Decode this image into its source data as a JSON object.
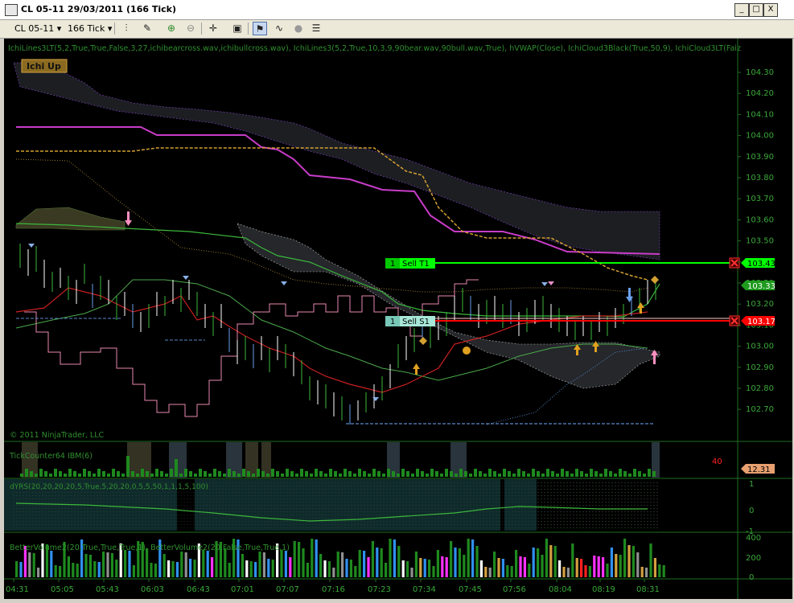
{
  "window": {
    "title": "CL 05-11  29/03/2011 (166 Tick)",
    "buttons": [
      "_",
      "□",
      "X"
    ]
  },
  "toolbar": {
    "instrument": "CL 05-11",
    "interval": "166 Tick"
  },
  "panel_main": {
    "indicator_line": "IchiLines3LT(5,2,True,True,False,3,27,ichibearcross.wav,ichibullcross.wav), IchiLines3(5,2,True,10,3,9,90bear.wav,90bull.wav,True), hVWAP(Close), IchiCloud3Black(True,50,9), IchiCloud3LT(Faiz",
    "badge": "Ichi Up",
    "copyright": "© 2011 NinjaTrader, LLC",
    "price_ticks": [
      "104.30",
      "104.20",
      "104.10",
      "104.00",
      "103.90",
      "103.80",
      "103.70",
      "103.60",
      "103.50",
      "103.40",
      "103.30",
      "103.20",
      "103.10",
      "103.00",
      "102.90",
      "102.80",
      "102.70"
    ],
    "orders": [
      {
        "qty": "1",
        "label": "Sell T1",
        "price": "103.43"
      },
      {
        "qty": "1",
        "label": "Sell S1",
        "price": "103.17"
      }
    ],
    "last_price": "103.33"
  },
  "panel_tick": {
    "label": "TickCounter64 IBM(6)",
    "value_red": "40",
    "price_tag": "12.31"
  },
  "panel_osc": {
    "label": "dYRS(20,20,20,20,5,True,5,20,20,0,5,5,50,1,1,1,5,100)",
    "ticks": [
      "1",
      "0",
      "-1"
    ]
  },
  "panel_volume": {
    "label": "BetterVolume2(20,True,True,True,1), BetterVolume2(20,False,True,True,1)",
    "ticks": [
      "400",
      "200",
      "0"
    ]
  },
  "time_axis": [
    "04:31",
    "05:05",
    "05:43",
    "06:03",
    "06:43",
    "07:01",
    "07:07",
    "07:16",
    "07:23",
    "07:34",
    "07:45",
    "07:56",
    "08:04",
    "08:19",
    "08:31"
  ],
  "colors": {
    "background": "#000000",
    "axis_text": "#3aa83a",
    "sell_target": "#00ff00",
    "sell_stop": "#ff0000",
    "badge": "#d4a340"
  }
}
